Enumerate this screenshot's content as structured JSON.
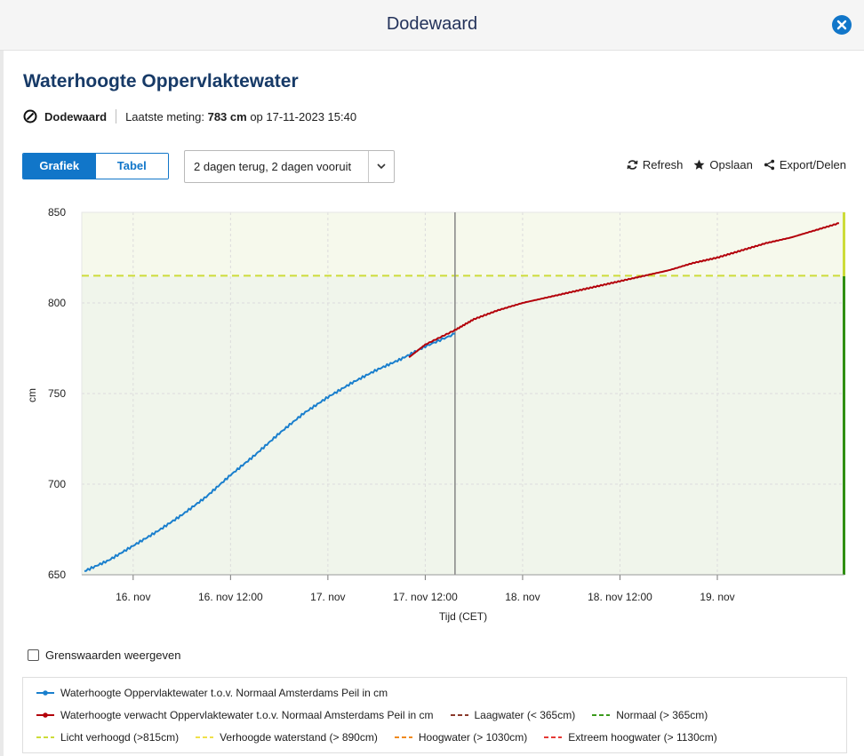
{
  "modal": {
    "title": "Dodewaard"
  },
  "page": {
    "title": "Waterhoogte Oppervlaktewater",
    "station": "Dodewaard",
    "last_label": "Laatste meting:",
    "last_value": "783 cm",
    "last_on": "op 17-11-2023 15:40"
  },
  "view_toggle": {
    "chart_label": "Grafiek",
    "table_label": "Tabel",
    "active": "Grafiek"
  },
  "range": {
    "selected": "2 dagen terug, 2 dagen vooruit"
  },
  "actions": {
    "refresh": "Refresh",
    "save": "Opslaan",
    "export": "Export/Delen"
  },
  "threshold_toggle": {
    "label": "Grenswaarden weergeven",
    "checked": false
  },
  "legend": [
    {
      "label": "Waterhoogte Oppervlaktewater t.o.v. Normaal Amsterdams Peil in cm",
      "color": "#1a7fcd",
      "style": "line-dot"
    },
    {
      "label": "Waterhoogte verwacht Oppervlaktewater t.o.v. Normaal Amsterdams Peil in cm",
      "color": "#b3000a",
      "style": "line-dot"
    },
    {
      "label": "Laagwater (< 365cm)",
      "color": "#8a3a2c",
      "style": "dash"
    },
    {
      "label": "Normaal (> 365cm)",
      "color": "#3b9a1c",
      "style": "dash"
    },
    {
      "label": "Licht verhoogd (>815cm)",
      "color": "#cddc39",
      "style": "dash"
    },
    {
      "label": "Verhoogde waterstand (> 890cm)",
      "color": "#f0e04a",
      "style": "dash"
    },
    {
      "label": "Hoogwater (> 1030cm)",
      "color": "#f08a1c",
      "style": "dash"
    },
    {
      "label": "Extreem hoogwater (> 1130cm)",
      "color": "#e53935",
      "style": "dash"
    }
  ],
  "chart_data": {
    "type": "line",
    "xlabel": "Tijd (CET)",
    "ylabel": "cm",
    "x_ticks": [
      "16. nov",
      "16. nov 12:00",
      "17. nov",
      "17. nov 12:00",
      "18. nov",
      "18. nov 12:00",
      "19. nov"
    ],
    "y_ticks": [
      650,
      700,
      750,
      800,
      850
    ],
    "ylim": [
      650,
      850
    ],
    "xlim": [
      "2023-11-15 17:40",
      "2023-11-19 15:40"
    ],
    "now": "2023-11-17 15:40",
    "grid": true,
    "threshold_line": {
      "name": "Licht verhoogd",
      "value": 815,
      "color": "#cddc39"
    },
    "series": [
      {
        "name": "Waterhoogte Oppervlaktewater t.o.v. Normaal Amsterdams Peil in cm",
        "color": "#1a7fcd",
        "x": [
          "2023-11-15 18:00",
          "2023-11-15 21:00",
          "2023-11-16 00:00",
          "2023-11-16 03:00",
          "2023-11-16 06:00",
          "2023-11-16 09:00",
          "2023-11-16 12:00",
          "2023-11-16 15:00",
          "2023-11-16 18:00",
          "2023-11-16 21:00",
          "2023-11-17 00:00",
          "2023-11-17 03:00",
          "2023-11-17 06:00",
          "2023-11-17 09:00",
          "2023-11-17 12:00",
          "2023-11-17 15:40"
        ],
        "values": [
          652,
          658,
          666,
          674,
          683,
          693,
          705,
          716,
          728,
          739,
          748,
          756,
          763,
          769,
          776,
          783
        ]
      },
      {
        "name": "Waterhoogte verwacht Oppervlaktewater t.o.v. Normaal Amsterdams Peil in cm",
        "color": "#b3000a",
        "x": [
          "2023-11-17 10:00",
          "2023-11-17 12:00",
          "2023-11-17 15:40",
          "2023-11-17 18:00",
          "2023-11-17 21:00",
          "2023-11-18 00:00",
          "2023-11-18 03:00",
          "2023-11-18 06:00",
          "2023-11-18 09:00",
          "2023-11-18 12:00",
          "2023-11-18 15:00",
          "2023-11-18 18:00",
          "2023-11-18 21:00",
          "2023-11-19 00:00",
          "2023-11-19 03:00",
          "2023-11-19 06:00",
          "2023-11-19 09:00",
          "2023-11-19 12:00",
          "2023-11-19 15:00"
        ],
        "values": [
          770,
          777,
          785,
          791,
          796,
          800,
          803,
          806,
          809,
          812,
          815,
          818,
          822,
          825,
          829,
          833,
          836,
          840,
          844
        ]
      }
    ]
  }
}
